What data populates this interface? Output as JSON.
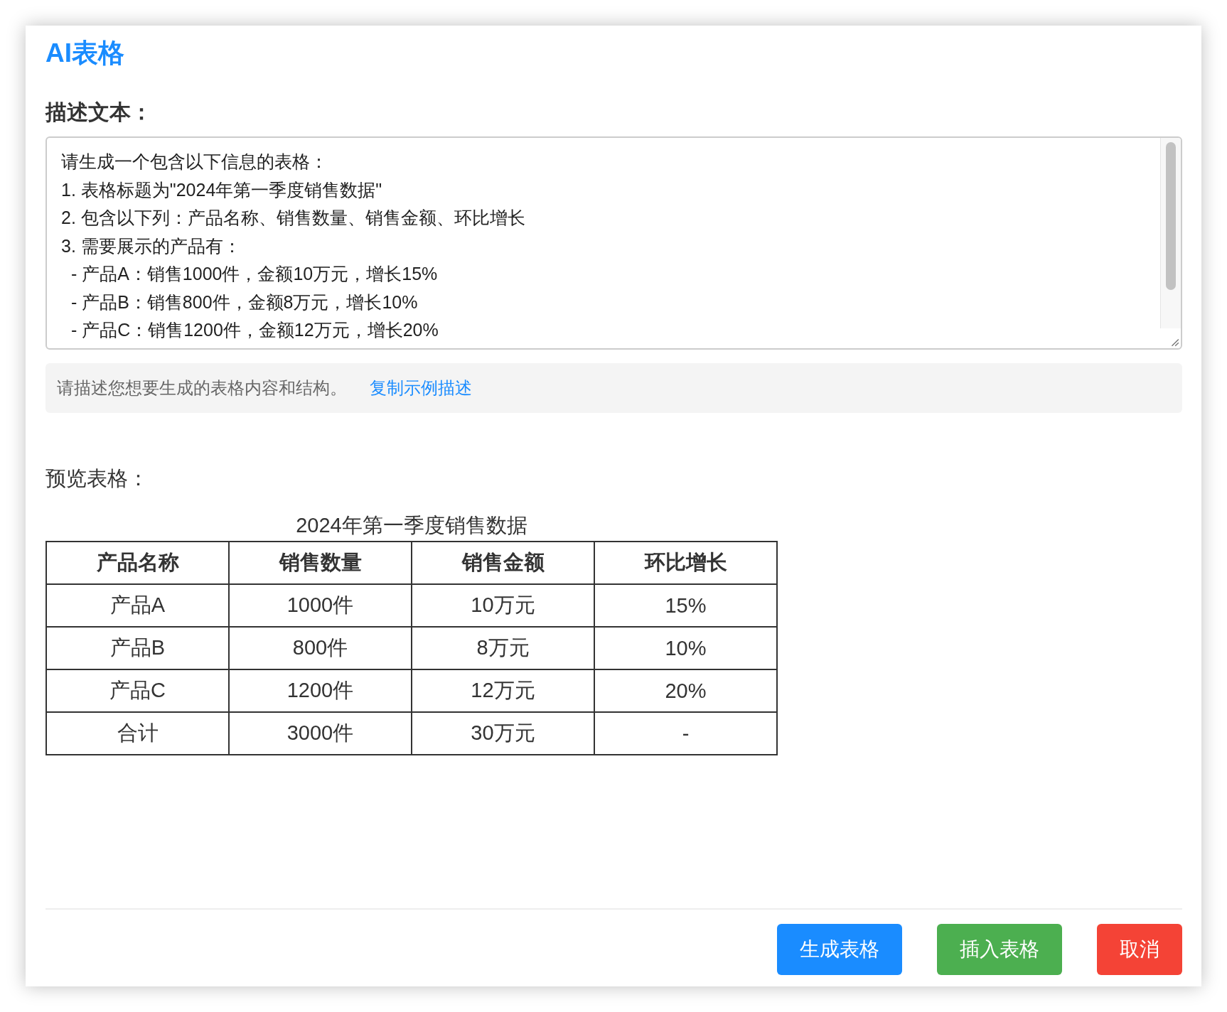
{
  "dialog": {
    "title": "AI表格"
  },
  "description": {
    "label": "描述文本：",
    "value": [
      "请生成一个包含以下信息的表格：",
      "1. 表格标题为\"2024年第一季度销售数据\"",
      "2. 包含以下列：产品名称、销售数量、销售金额、环比增长",
      "3. 需要展示的产品有：",
      "  - 产品A：销售1000件，金额10万元，增长15%",
      "  - 产品B：销售800件，金额8万元，增长10%",
      "  - 产品C：销售1200件，金额12万元，增长20%"
    ]
  },
  "hint": {
    "text": "请描述您想要生成的表格内容和结构。",
    "link": "复制示例描述"
  },
  "preview": {
    "label": "预览表格：",
    "caption": "2024年第一季度销售数据",
    "columns": [
      "产品名称",
      "销售数量",
      "销售金额",
      "环比增长"
    ],
    "rows": [
      [
        "产品A",
        "1000件",
        "10万元",
        "15%"
      ],
      [
        "产品B",
        "800件",
        "8万元",
        "10%"
      ],
      [
        "产品C",
        "1200件",
        "12万元",
        "20%"
      ],
      [
        "合计",
        "3000件",
        "30万元",
        "-"
      ]
    ]
  },
  "buttons": [
    {
      "label": "生成表格",
      "kind": "primary"
    },
    {
      "label": "插入表格",
      "kind": "success"
    },
    {
      "label": "取消",
      "kind": "danger"
    }
  ]
}
